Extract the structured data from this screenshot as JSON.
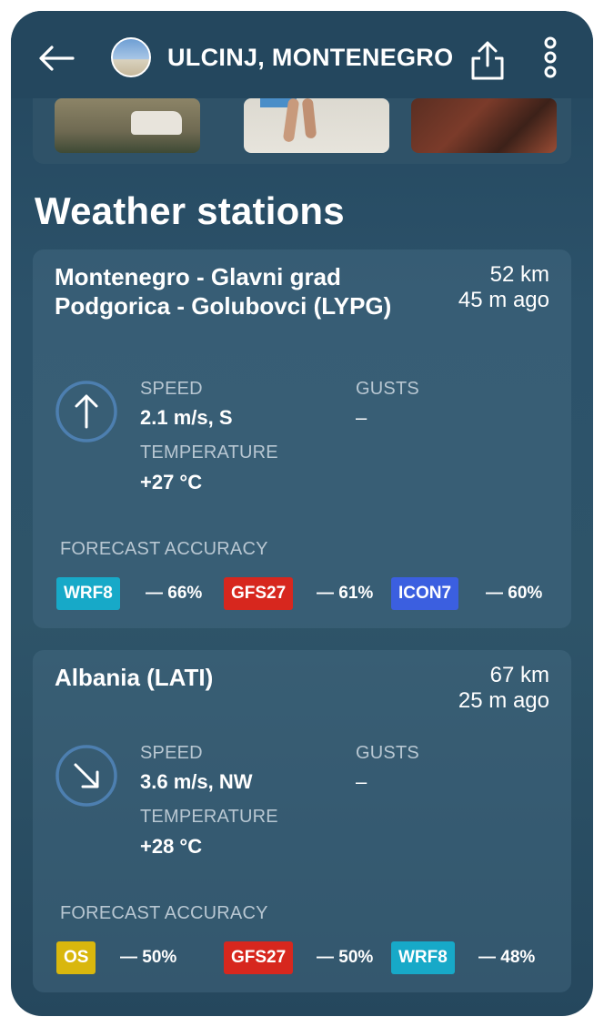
{
  "header": {
    "title": "ULCINJ, MONTENEGRO",
    "back_icon": "arrow-left-icon",
    "share_icon": "share-icon",
    "more_icon": "more-vertical-icon"
  },
  "photos": [
    "photo-1",
    "photo-2",
    "photo-3"
  ],
  "section_title": "Weather stations",
  "labels": {
    "speed": "SPEED",
    "gusts": "GUSTS",
    "temperature": "TEMPERATURE",
    "forecast_accuracy": "FORECAST ACCURACY"
  },
  "stations": [
    {
      "name": "Montenegro - Glavni grad Podgorica - Golubovci (LYPG)",
      "distance": "52 km",
      "updated": "45 m ago",
      "wind_direction_icon": "arrow-up-icon",
      "speed": "2.1 m/s, S",
      "gusts": "–",
      "temperature": "+27 °C",
      "accuracy": [
        {
          "model": "WRF8",
          "value": "— 66%",
          "color": "#17a9c8"
        },
        {
          "model": "GFS27",
          "value": "— 61%",
          "color": "#d7271e"
        },
        {
          "model": "ICON7",
          "value": "— 60%",
          "color": "#3b5fe0"
        }
      ]
    },
    {
      "name": "Albania (LATI)",
      "distance": "67 km",
      "updated": "25 m ago",
      "wind_direction_icon": "arrow-down-right-icon",
      "speed": "3.6 m/s, NW",
      "gusts": "–",
      "temperature": "+28 °C",
      "accuracy": [
        {
          "model": "OS",
          "value": "— 50%",
          "color": "#d9b70d"
        },
        {
          "model": "GFS27",
          "value": "— 50%",
          "color": "#d7271e"
        },
        {
          "model": "WRF8",
          "value": "— 48%",
          "color": "#17a9c8"
        }
      ]
    }
  ]
}
